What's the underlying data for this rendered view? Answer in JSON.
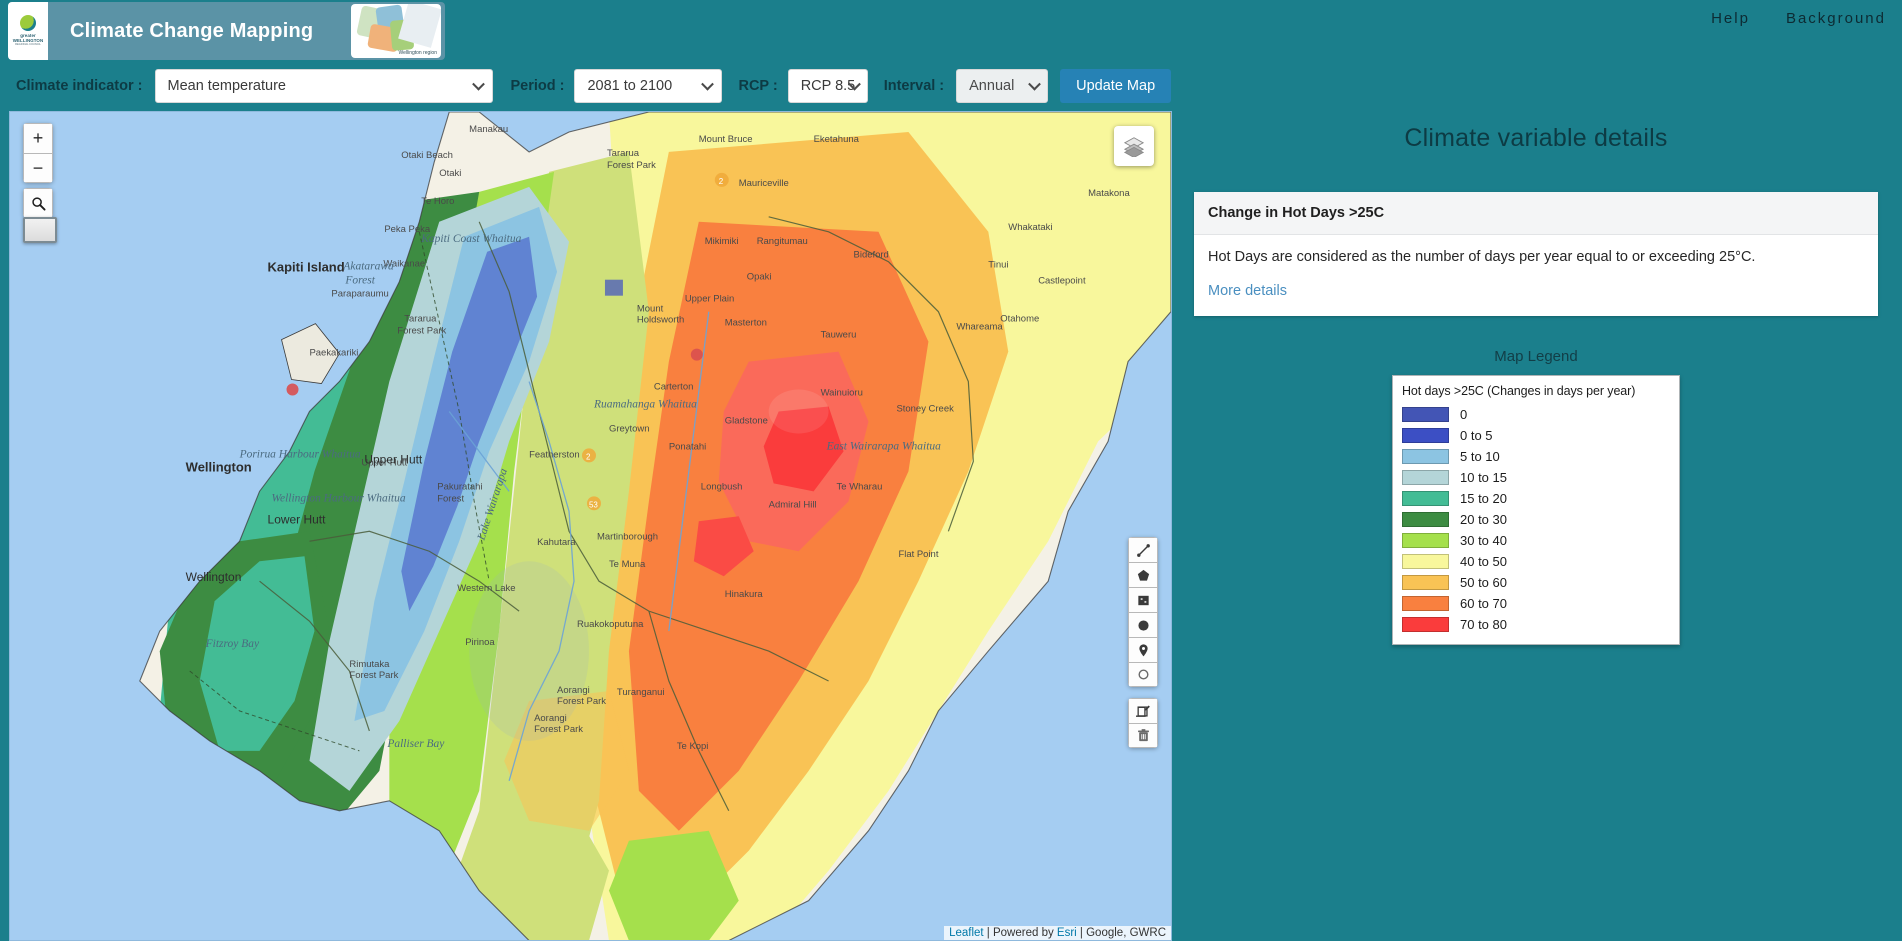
{
  "header": {
    "title": "Climate Change Mapping",
    "logo_name": "greater WELLINGTON",
    "logo_sub": "REGIONAL COUNCIL",
    "map_caption": "Wellington region",
    "nav": [
      {
        "label": "Help",
        "name": "nav-help"
      },
      {
        "label": "Background",
        "name": "nav-background"
      }
    ]
  },
  "controls": {
    "indicator_label": "Climate indicator :",
    "indicator_value": "Mean temperature",
    "period_label": "Period :",
    "period_value": "2081 to 2100",
    "rcp_label": "RCP :",
    "rcp_value": "RCP 8.5",
    "interval_label": "Interval :",
    "interval_value": "Annual",
    "update_label": "Update Map"
  },
  "map": {
    "zoom_in": "+",
    "zoom_out": "−",
    "search_icon": "search-icon",
    "basemap_icon": "basemap-swatch-icon",
    "layers_icon": "layers-icon",
    "draw_tools": [
      {
        "name": "draw-polyline-button",
        "icon": "polyline-icon"
      },
      {
        "name": "draw-polygon-button",
        "icon": "polygon-icon"
      },
      {
        "name": "draw-rectangle-button",
        "icon": "rectangle-icon"
      },
      {
        "name": "draw-circle-button",
        "icon": "circle-icon"
      },
      {
        "name": "draw-marker-button",
        "icon": "marker-icon"
      },
      {
        "name": "draw-circlemarker-button",
        "icon": "circlemarker-icon"
      }
    ],
    "edit_tools": [
      {
        "name": "edit-layers-button",
        "icon": "edit-icon"
      },
      {
        "name": "delete-layers-button",
        "icon": "trash-icon"
      }
    ],
    "attribution": {
      "leaflet": "Leaflet",
      "sep1": " | Powered by ",
      "esri": "Esri",
      "sep2": " | Google, GWRC"
    },
    "place_labels": [
      "Manakau",
      "Otaki Beach",
      "Otaki",
      "Te Horo",
      "Peka Peka",
      "Kapiti Island",
      "Waikanae",
      "Paraparaumu",
      "Paekakariki",
      "Tararua Forest Park",
      "Kapiti Coast Whaitua",
      "Mount Bruce",
      "Mauriceville",
      "Eketahuna",
      "Mikimiki",
      "Rangitumau",
      "Bideford",
      "Tinui",
      "Whakataki",
      "Castlepoint",
      "Matakona",
      "Opaki",
      "Upper Plain",
      "Mount Holdsworth",
      "Masterton",
      "Tauweru",
      "Whareama",
      "Otahome",
      "Akatarawa Forest",
      "Carterton",
      "Ruamahanga Whaitua",
      "Greytown",
      "Gladstone",
      "Wainuioru",
      "Stoney Creek",
      "Porirua Harbour Whaitua",
      "Upper Hutt",
      "Pakuratahi Forest",
      "Featherston",
      "Ponatahi",
      "Longbush",
      "Admiral Hill",
      "Te Wharau",
      "East Wairarapa Whaitua",
      "Wellington Harbour Whaitua",
      "Lower Hutt",
      "Wellington",
      "Lake Wairarapa",
      "Kahutara",
      "Martinborough",
      "Te Muna",
      "Flat Point",
      "Western Lake",
      "Hinakura",
      "Ruakokoputuna",
      "Pirinoa",
      "Fitzroy Bay",
      "Rimutaka Forest Park",
      "Aorangi Forest Park",
      "Turanganui",
      "Palliser Bay",
      "Te Kopi"
    ]
  },
  "panel": {
    "title": "Climate variable details",
    "detail_heading": "Change in Hot Days >25C",
    "detail_text": "Hot Days are considered as the number of days per year equal to or exceeding 25°C.",
    "more_details_label": "More details",
    "legend_title": "Map Legend"
  },
  "chart_data": {
    "type": "legend",
    "title": "Hot days >25C (Changes in days per year)",
    "categories": [
      "0",
      "0 to 5",
      "5 to 10",
      "10 to 15",
      "15 to 20",
      "20 to 30",
      "30 to 40",
      "40 to 50",
      "50 to 60",
      "60 to 70",
      "70 to 80"
    ],
    "colors": [
      "#4355b5",
      "#3c4fc4",
      "#8cc4e2",
      "#b4d5d8",
      "#43bc95",
      "#3d8c42",
      "#a5e04c",
      "#f8f79c",
      "#f9c355",
      "#f9803f",
      "#fa3c3c"
    ],
    "items": [
      {
        "label": "0",
        "color": "#4355b5"
      },
      {
        "label": "0 to 5",
        "color": "#3c4fc4"
      },
      {
        "label": "5 to 10",
        "color": "#8cc4e2"
      },
      {
        "label": "10 to 15",
        "color": "#b4d5d8"
      },
      {
        "label": "15 to 20",
        "color": "#43bc95"
      },
      {
        "label": "20 to 30",
        "color": "#3d8c42"
      },
      {
        "label": "30 to 40",
        "color": "#a5e04c"
      },
      {
        "label": "40 to 50",
        "color": "#f8f79c"
      },
      {
        "label": "50 to 60",
        "color": "#f9c355"
      },
      {
        "label": "60 to 70",
        "color": "#f9803f"
      },
      {
        "label": "70 to 80",
        "color": "#fa3c3c"
      }
    ]
  },
  "theme": {
    "brand_teal": "#1b7f8c",
    "button_blue": "#2682b5",
    "link_blue": "#4a8fc0",
    "water_blue": "#a5cdf2"
  }
}
